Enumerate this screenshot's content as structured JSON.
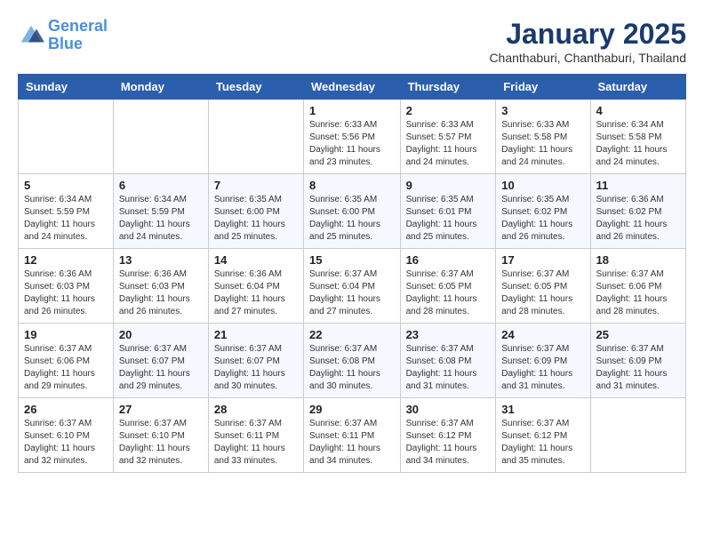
{
  "header": {
    "logo_line1": "General",
    "logo_line2": "Blue",
    "month": "January 2025",
    "location": "Chanthaburi, Chanthaburi, Thailand"
  },
  "weekdays": [
    "Sunday",
    "Monday",
    "Tuesday",
    "Wednesday",
    "Thursday",
    "Friday",
    "Saturday"
  ],
  "weeks": [
    [
      {
        "day": "",
        "info": ""
      },
      {
        "day": "",
        "info": ""
      },
      {
        "day": "",
        "info": ""
      },
      {
        "day": "1",
        "info": "Sunrise: 6:33 AM\nSunset: 5:56 PM\nDaylight: 11 hours\nand 23 minutes."
      },
      {
        "day": "2",
        "info": "Sunrise: 6:33 AM\nSunset: 5:57 PM\nDaylight: 11 hours\nand 24 minutes."
      },
      {
        "day": "3",
        "info": "Sunrise: 6:33 AM\nSunset: 5:58 PM\nDaylight: 11 hours\nand 24 minutes."
      },
      {
        "day": "4",
        "info": "Sunrise: 6:34 AM\nSunset: 5:58 PM\nDaylight: 11 hours\nand 24 minutes."
      }
    ],
    [
      {
        "day": "5",
        "info": "Sunrise: 6:34 AM\nSunset: 5:59 PM\nDaylight: 11 hours\nand 24 minutes."
      },
      {
        "day": "6",
        "info": "Sunrise: 6:34 AM\nSunset: 5:59 PM\nDaylight: 11 hours\nand 24 minutes."
      },
      {
        "day": "7",
        "info": "Sunrise: 6:35 AM\nSunset: 6:00 PM\nDaylight: 11 hours\nand 25 minutes."
      },
      {
        "day": "8",
        "info": "Sunrise: 6:35 AM\nSunset: 6:00 PM\nDaylight: 11 hours\nand 25 minutes."
      },
      {
        "day": "9",
        "info": "Sunrise: 6:35 AM\nSunset: 6:01 PM\nDaylight: 11 hours\nand 25 minutes."
      },
      {
        "day": "10",
        "info": "Sunrise: 6:35 AM\nSunset: 6:02 PM\nDaylight: 11 hours\nand 26 minutes."
      },
      {
        "day": "11",
        "info": "Sunrise: 6:36 AM\nSunset: 6:02 PM\nDaylight: 11 hours\nand 26 minutes."
      }
    ],
    [
      {
        "day": "12",
        "info": "Sunrise: 6:36 AM\nSunset: 6:03 PM\nDaylight: 11 hours\nand 26 minutes."
      },
      {
        "day": "13",
        "info": "Sunrise: 6:36 AM\nSunset: 6:03 PM\nDaylight: 11 hours\nand 26 minutes."
      },
      {
        "day": "14",
        "info": "Sunrise: 6:36 AM\nSunset: 6:04 PM\nDaylight: 11 hours\nand 27 minutes."
      },
      {
        "day": "15",
        "info": "Sunrise: 6:37 AM\nSunset: 6:04 PM\nDaylight: 11 hours\nand 27 minutes."
      },
      {
        "day": "16",
        "info": "Sunrise: 6:37 AM\nSunset: 6:05 PM\nDaylight: 11 hours\nand 28 minutes."
      },
      {
        "day": "17",
        "info": "Sunrise: 6:37 AM\nSunset: 6:05 PM\nDaylight: 11 hours\nand 28 minutes."
      },
      {
        "day": "18",
        "info": "Sunrise: 6:37 AM\nSunset: 6:06 PM\nDaylight: 11 hours\nand 28 minutes."
      }
    ],
    [
      {
        "day": "19",
        "info": "Sunrise: 6:37 AM\nSunset: 6:06 PM\nDaylight: 11 hours\nand 29 minutes."
      },
      {
        "day": "20",
        "info": "Sunrise: 6:37 AM\nSunset: 6:07 PM\nDaylight: 11 hours\nand 29 minutes."
      },
      {
        "day": "21",
        "info": "Sunrise: 6:37 AM\nSunset: 6:07 PM\nDaylight: 11 hours\nand 30 minutes."
      },
      {
        "day": "22",
        "info": "Sunrise: 6:37 AM\nSunset: 6:08 PM\nDaylight: 11 hours\nand 30 minutes."
      },
      {
        "day": "23",
        "info": "Sunrise: 6:37 AM\nSunset: 6:08 PM\nDaylight: 11 hours\nand 31 minutes."
      },
      {
        "day": "24",
        "info": "Sunrise: 6:37 AM\nSunset: 6:09 PM\nDaylight: 11 hours\nand 31 minutes."
      },
      {
        "day": "25",
        "info": "Sunrise: 6:37 AM\nSunset: 6:09 PM\nDaylight: 11 hours\nand 31 minutes."
      }
    ],
    [
      {
        "day": "26",
        "info": "Sunrise: 6:37 AM\nSunset: 6:10 PM\nDaylight: 11 hours\nand 32 minutes."
      },
      {
        "day": "27",
        "info": "Sunrise: 6:37 AM\nSunset: 6:10 PM\nDaylight: 11 hours\nand 32 minutes."
      },
      {
        "day": "28",
        "info": "Sunrise: 6:37 AM\nSunset: 6:11 PM\nDaylight: 11 hours\nand 33 minutes."
      },
      {
        "day": "29",
        "info": "Sunrise: 6:37 AM\nSunset: 6:11 PM\nDaylight: 11 hours\nand 34 minutes."
      },
      {
        "day": "30",
        "info": "Sunrise: 6:37 AM\nSunset: 6:12 PM\nDaylight: 11 hours\nand 34 minutes."
      },
      {
        "day": "31",
        "info": "Sunrise: 6:37 AM\nSunset: 6:12 PM\nDaylight: 11 hours\nand 35 minutes."
      },
      {
        "day": "",
        "info": ""
      }
    ]
  ]
}
